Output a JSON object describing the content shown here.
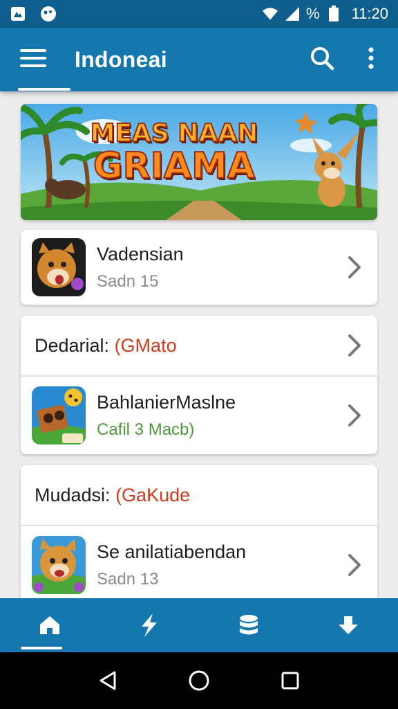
{
  "status_bar": {
    "battery_pct": "%",
    "time": "11:20",
    "icons": [
      "image-icon",
      "face-icon",
      "wifi-icon",
      "signal-icon",
      "battery-icon"
    ]
  },
  "app_bar": {
    "title": "Indoneai",
    "icons": [
      "menu-icon",
      "search-icon",
      "more-vert-icon"
    ]
  },
  "banner": {
    "line1": "MEAS NAAN",
    "line2": "GRIAMA"
  },
  "items": [
    {
      "title": "Vadensian",
      "subtitle": "Sadn 15"
    },
    {
      "title": "BahlanierMaslne",
      "subtitle": "Cafil 3 Macb)"
    },
    {
      "title": "Se anilatiabendan",
      "subtitle": "Sadn 13"
    }
  ],
  "sections": [
    {
      "label": "Dedarial: ",
      "accent": "(GMato"
    },
    {
      "label": "Mudadsi: ",
      "accent": "(GaKude"
    }
  ],
  "bottom_nav": {
    "items": [
      "home-icon",
      "bolt-icon",
      "database-icon",
      "download-icon"
    ],
    "selected": 0
  },
  "system_nav": [
    "back-icon",
    "home-circle-icon",
    "recents-icon"
  ],
  "colors": {
    "status_bar": "#0d5e8c",
    "primary": "#1478ae",
    "accent_text": "#cf3a1d",
    "green_text": "#4b9a3a"
  }
}
